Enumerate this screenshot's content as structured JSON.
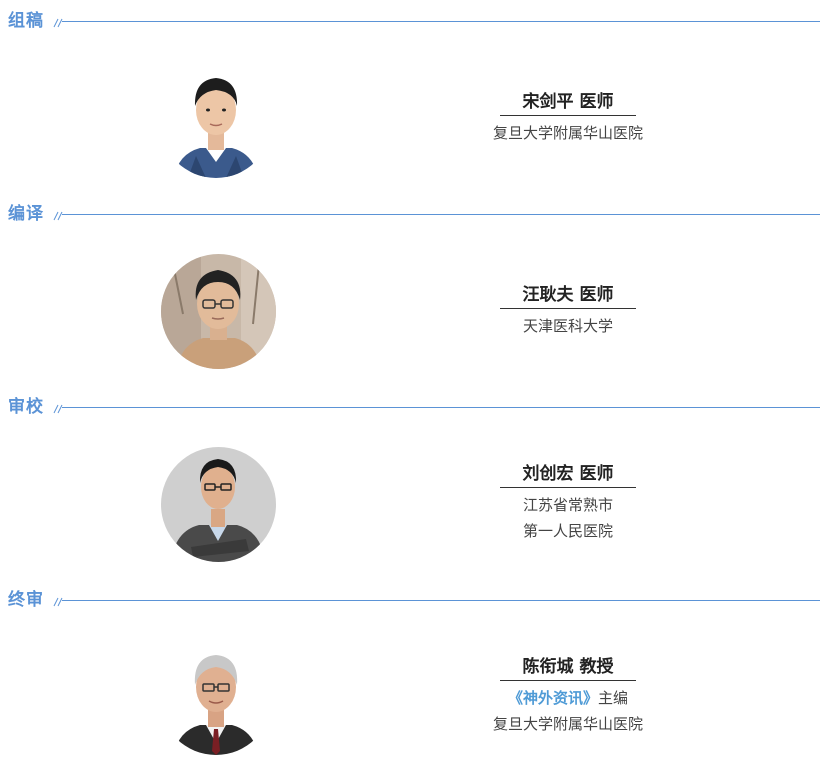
{
  "sections": [
    {
      "title": "组稿",
      "person": {
        "name": "宋剑平 医师",
        "org_lines": [
          "复旦大学附属华山医院"
        ]
      }
    },
    {
      "title": "编译",
      "person": {
        "name": "汪耿夫 医师",
        "org_lines": [
          "天津医科大学"
        ]
      }
    },
    {
      "title": "审校",
      "person": {
        "name": "刘创宏 医师",
        "org_lines": [
          "江苏省常熟市",
          "第一人民医院"
        ]
      }
    },
    {
      "title": "终审",
      "person": {
        "name": "陈衔城 教授",
        "journal": "《神外资讯》",
        "journal_role": "主编",
        "org_lines": [
          "复旦大学附属华山医院"
        ]
      }
    }
  ],
  "colors": {
    "accent": "#5b93d6",
    "journal_highlight": "#4f9bd6"
  },
  "icons": {
    "header_mark": "double-slash-icon"
  }
}
